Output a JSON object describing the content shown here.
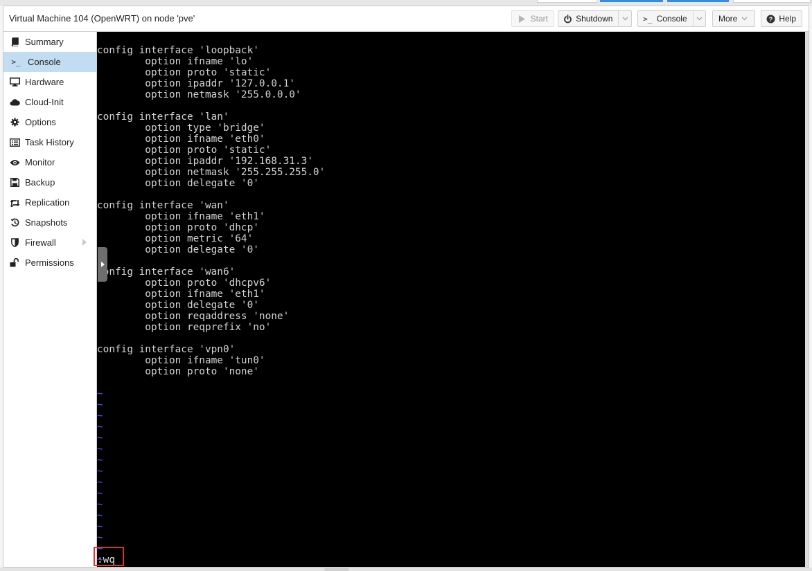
{
  "window": {
    "title": "Virtual Machine 104 (OpenWRT) on node 'pve'"
  },
  "toolbar": {
    "start": {
      "label": "Start",
      "icon": "play-icon",
      "enabled": false
    },
    "shutdown": {
      "label": "Shutdown",
      "icon": "power-icon"
    },
    "console": {
      "label": "Console",
      "icon": "terminal-icon"
    },
    "more": {
      "label": "More"
    },
    "help": {
      "label": "Help",
      "icon": "question-icon"
    }
  },
  "sidebar": {
    "items": [
      {
        "label": "Summary",
        "icon": "book-icon"
      },
      {
        "label": "Console",
        "icon": "terminal-prompt-icon",
        "active": true
      },
      {
        "label": "Hardware",
        "icon": "monitor-icon"
      },
      {
        "label": "Cloud-Init",
        "icon": "cloud-icon"
      },
      {
        "label": "Options",
        "icon": "gear-icon"
      },
      {
        "label": "Task History",
        "icon": "list-icon"
      },
      {
        "label": "Monitor",
        "icon": "eye-icon"
      },
      {
        "label": "Backup",
        "icon": "floppy-icon"
      },
      {
        "label": "Replication",
        "icon": "retweet-icon"
      },
      {
        "label": "Snapshots",
        "icon": "history-icon"
      },
      {
        "label": "Firewall",
        "icon": "shield-icon",
        "has_submenu": true
      },
      {
        "label": "Permissions",
        "icon": "unlock-icon"
      }
    ]
  },
  "terminal": {
    "content": "config interface 'loopback'\n        option ifname 'lo'\n        option proto 'static'\n        option ipaddr '127.0.0.1'\n        option netmask '255.0.0.0'\n\nconfig interface 'lan'\n        option type 'bridge'\n        option ifname 'eth0'\n        option proto 'static'\n        option ipaddr '192.168.31.3'\n        option netmask '255.255.255.0'\n        option delegate '0'\n\nconfig interface 'wan'\n        option ifname 'eth1'\n        option proto 'dhcp'\n        option metric '64'\n        option delegate '0'\n\nconfig interface 'wan6'\n        option proto 'dhcpv6'\n        option ifname 'eth1'\n        option delegate '0'\n        option reqaddress 'none'\n        option reqprefix 'no'\n\nconfig interface 'vpn0'\n        option ifname 'tun0'\n        option proto 'none'",
    "empty_line_marker": "~\n~\n~\n~\n~\n~\n~\n~\n~\n~\n~\n~\n~\n~\n~\n~",
    "command_line": ":wq_"
  },
  "colors": {
    "accent": "#3a8ad6",
    "active_nav": "#c2ddf2",
    "terminal_bg": "#000000",
    "terminal_fg": "#d3d3d3",
    "tilde": "#5a5aff",
    "highlight_box": "#e03030"
  }
}
